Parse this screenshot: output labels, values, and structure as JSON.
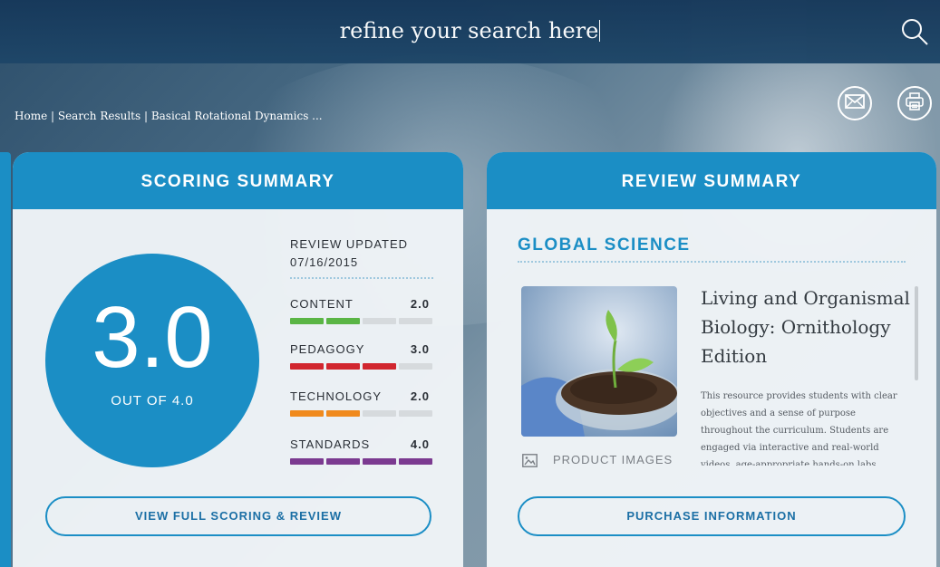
{
  "search": {
    "value": "refine your search here"
  },
  "breadcrumb": {
    "text": "Home | Search Results | Basical Rotational Dynamics ..."
  },
  "scoring": {
    "header": "SCORING SUMMARY",
    "score": "3.0",
    "out_of": "OUT OF 4.0",
    "review_updated_label": "REVIEW UPDATED",
    "review_updated_date": "07/16/2015",
    "categories": [
      {
        "label": "CONTENT",
        "value": "2.0",
        "filled": 2,
        "color": "#5ab545"
      },
      {
        "label": "PEDAGOGY",
        "value": "3.0",
        "filled": 3,
        "color": "#d1262f"
      },
      {
        "label": "TECHNOLOGY",
        "value": "2.0",
        "filled": 2,
        "color": "#f08a1d"
      },
      {
        "label": "STANDARDS",
        "value": "4.0",
        "filled": 4,
        "color": "#7b3a90"
      }
    ],
    "button": "VIEW FULL SCORING & REVIEW"
  },
  "review": {
    "header": "REVIEW SUMMARY",
    "publisher": "GLOBAL SCIENCE",
    "title": "Living and Organismal Biology: Ornithology Edition",
    "description": "This resource provides students with clear objectives and a sense of purpose throughout the curriculum. Students are engaged via interactive and real-world videos, age-appropriate hands-on labs,",
    "product_images_label": "PRODUCT IMAGES",
    "button": "PURCHASE INFORMATION"
  },
  "icons": {
    "search": "search-icon",
    "email": "email-icon",
    "print": "print-icon",
    "image": "image-icon"
  },
  "colors": {
    "brand_blue": "#1b8ec5",
    "topbar": "#16385a",
    "empty_bar": "#d6dadd"
  }
}
